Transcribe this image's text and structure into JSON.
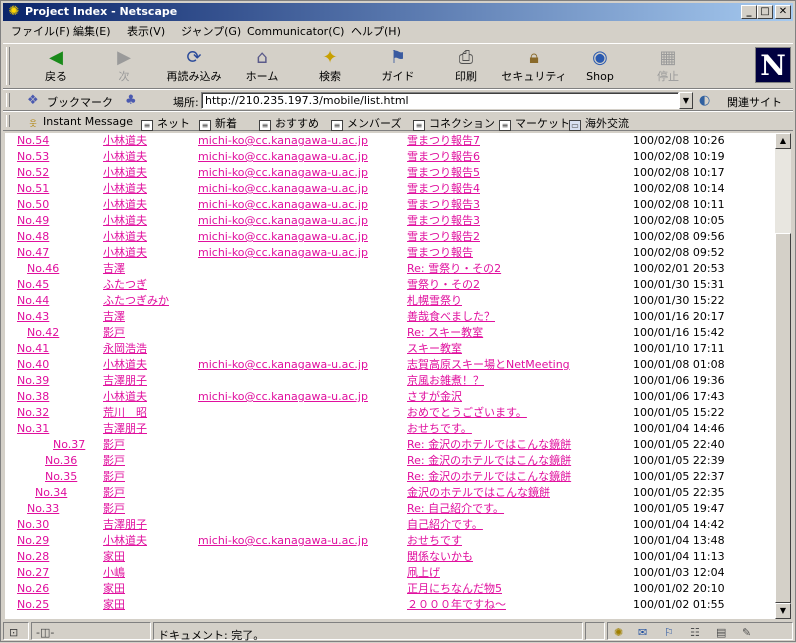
{
  "window": {
    "title": "Project Index - Netscape"
  },
  "menu": [
    "ファイル(F)",
    "編集(E)",
    "表示(V)",
    "ジャンプ(G)",
    "Communicator(C)",
    "ヘルプ(H)"
  ],
  "toolbar": {
    "back": "戻る",
    "forward": "次",
    "reload": "再読み込み",
    "home": "ホーム",
    "search": "検索",
    "guide": "ガイド",
    "print": "印刷",
    "security": "セキュリティ",
    "shop": "Shop",
    "stop": "停止"
  },
  "location": {
    "bookmarks": "ブックマーク",
    "label": "場所:",
    "url": "http://210.235.197.3/mobile/list.html",
    "related": "関連サイト"
  },
  "personal": [
    "Instant Message",
    "ネット",
    "新着",
    "おすすめ",
    "メンバーズ",
    "コネクション",
    "マーケット",
    "海外交流"
  ],
  "rows": [
    {
      "no": "No.54",
      "name": "小林道夫",
      "email": "michi-ko@cc.kanagawa-u.ac.jp",
      "subject": "雪まつり報告7",
      "date": "100/02/08 10:26"
    },
    {
      "no": "No.53",
      "name": "小林道夫",
      "email": "michi-ko@cc.kanagawa-u.ac.jp",
      "subject": "雪まつり報告6",
      "date": "100/02/08 10:19"
    },
    {
      "no": "No.52",
      "name": "小林道夫",
      "email": "michi-ko@cc.kanagawa-u.ac.jp",
      "subject": "雪まつり報告5",
      "date": "100/02/08 10:17"
    },
    {
      "no": "No.51",
      "name": "小林道夫",
      "email": "michi-ko@cc.kanagawa-u.ac.jp",
      "subject": "雪まつり報告4",
      "date": "100/02/08 10:14"
    },
    {
      "no": "No.50",
      "name": "小林道夫",
      "email": "michi-ko@cc.kanagawa-u.ac.jp",
      "subject": "雪まつり報告3",
      "date": "100/02/08 10:11"
    },
    {
      "no": "No.49",
      "name": "小林道夫",
      "email": "michi-ko@cc.kanagawa-u.ac.jp",
      "subject": "雪まつり報告3",
      "date": "100/02/08 10:05"
    },
    {
      "no": "No.48",
      "name": "小林道夫",
      "email": "michi-ko@cc.kanagawa-u.ac.jp",
      "subject": "雪まつり報告2",
      "date": "100/02/08 09:56"
    },
    {
      "no": "No.47",
      "name": "小林道夫",
      "email": "michi-ko@cc.kanagawa-u.ac.jp",
      "subject": "雪まつり報告",
      "date": "100/02/08 09:52"
    },
    {
      "no": "No.46",
      "name": "吉澤",
      "email": "",
      "subject": "Re: 雪祭り・その2",
      "date": "100/02/01 20:53"
    },
    {
      "no": "No.45",
      "name": "ふたつぎ",
      "email": "",
      "subject": "雪祭り・その2",
      "date": "100/01/30 15:31"
    },
    {
      "no": "No.44",
      "name": "ふたつぎみか",
      "email": "",
      "subject": "札幌雪祭り",
      "date": "100/01/30 15:22"
    },
    {
      "no": "No.43",
      "name": "吉澤",
      "email": "",
      "subject": "善哉食べました？",
      "date": "100/01/16 20:17"
    },
    {
      "no": "No.42",
      "name": "影戸",
      "email": "",
      "subject": "Re: スキー教室",
      "date": "100/01/16 15:42"
    },
    {
      "no": "No.41",
      "name": "永岡浩浩",
      "email": "",
      "subject": "スキー教室",
      "date": "100/01/10 17:11"
    },
    {
      "no": "No.40",
      "name": "小林道夫",
      "email": "michi-ko@cc.kanagawa-u.ac.jp",
      "subject": "志賀高原スキー場とNetMeeting",
      "date": "100/01/08 01:08"
    },
    {
      "no": "No.39",
      "name": "吉澤朋子",
      "email": "",
      "subject": "京風お雑煮！？",
      "date": "100/01/06 19:36"
    },
    {
      "no": "No.38",
      "name": "小林道夫",
      "email": "michi-ko@cc.kanagawa-u.ac.jp",
      "subject": "さすが金沢",
      "date": "100/01/06 17:43"
    },
    {
      "no": "No.32",
      "name": "荒川　昭",
      "email": "",
      "subject": "おめでとうございます。",
      "date": "100/01/05 15:22"
    },
    {
      "no": "No.31",
      "name": "吉澤朋子",
      "email": "",
      "subject": "おせちです。",
      "date": "100/01/04 14:46"
    },
    {
      "no": "No.37",
      "name": "影戸",
      "email": "",
      "subject": "Re: 金沢のホテルではこんな鏡餅",
      "date": "100/01/05 22:40"
    },
    {
      "no": "No.36",
      "name": "影戸",
      "email": "",
      "subject": "Re: 金沢のホテルではこんな鏡餅",
      "date": "100/01/05 22:39"
    },
    {
      "no": "No.35",
      "name": "影戸",
      "email": "",
      "subject": "Re: 金沢のホテルではこんな鏡餅",
      "date": "100/01/05 22:37"
    },
    {
      "no": "No.34",
      "name": "影戸",
      "email": "",
      "subject": "金沢のホテルではこんな鏡餅",
      "date": "100/01/05 22:35"
    },
    {
      "no": "No.33",
      "name": "影戸",
      "email": "",
      "subject": "Re: 自己紹介です。",
      "date": "100/01/05 19:47"
    },
    {
      "no": "No.30",
      "name": "吉澤朋子",
      "email": "",
      "subject": "自己紹介です。",
      "date": "100/01/04 14:42"
    },
    {
      "no": "No.29",
      "name": "小林道夫",
      "email": "michi-ko@cc.kanagawa-u.ac.jp",
      "subject": "おせちです",
      "date": "100/01/04 13:48"
    },
    {
      "no": "No.28",
      "name": "家田",
      "email": "",
      "subject": "関係ないかも",
      "date": "100/01/04 11:13"
    },
    {
      "no": "No.27",
      "name": "小嶋",
      "email": "",
      "subject": "凧上げ",
      "date": "100/01/03 12:04"
    },
    {
      "no": "No.26",
      "name": "家田",
      "email": "",
      "subject": "正月にちなんだ物5",
      "date": "100/01/02 20:10"
    },
    {
      "no": "No.25",
      "name": "家田",
      "email": "",
      "subject": "２０００年ですね～",
      "date": "100/01/02 01:55"
    }
  ],
  "status": {
    "text": "ドキュメント: 完了。"
  }
}
